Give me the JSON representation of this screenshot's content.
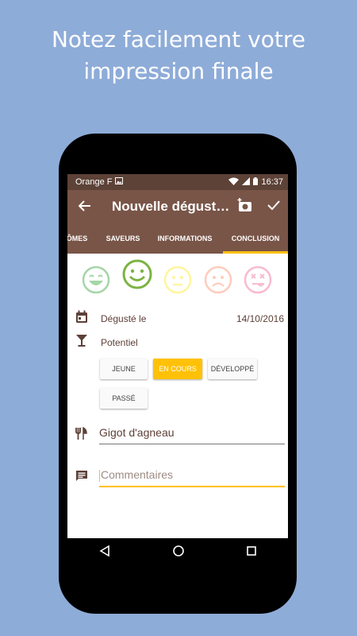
{
  "promo": {
    "headline_line1": "Notez facilement votre",
    "headline_line2": "impression finale"
  },
  "status_bar": {
    "carrier": "Orange F",
    "time": "16:37",
    "icons": [
      "image-icon",
      "wifi-icon",
      "signal-icon",
      "battery-icon"
    ]
  },
  "app_bar": {
    "title": "Nouvelle dégustati…",
    "actions": [
      "back-arrow-icon",
      "add-photo-icon",
      "check-icon"
    ]
  },
  "tabs": [
    {
      "label": "ÔMES",
      "active": false
    },
    {
      "label": "SAVEURS",
      "active": false
    },
    {
      "label": "INFORMATIONS",
      "active": false
    },
    {
      "label": "CONCLUSION",
      "active": true
    }
  ],
  "ratings": {
    "options": [
      "very-happy-face-icon",
      "smiling-face-icon",
      "neutral-face-icon",
      "sad-face-icon",
      "dead-face-icon"
    ],
    "selected_index": 1,
    "colors": [
      "#a5d6a7",
      "#8bc34a",
      "#fff59d",
      "#ffccbc",
      "#f8bbd0"
    ]
  },
  "tasted": {
    "label": "Dégusté le",
    "date": "14/10/2016",
    "icon": "calendar-icon"
  },
  "potential": {
    "label": "Potentiel",
    "icon": "wine-glass-icon",
    "options": [
      "JEUNE",
      "EN COURS",
      "DÉVELOPPÉ",
      "PASSÉ"
    ],
    "selected": "EN COURS"
  },
  "pairing": {
    "value": "Gigot d'agneau",
    "icon": "fork-knife-icon"
  },
  "comments": {
    "placeholder": "Commentaires",
    "icon": "comment-icon"
  },
  "nav": [
    "back-triangle-icon",
    "home-circle-icon",
    "recents-square-icon"
  ],
  "colors": {
    "background": "#8eacd8",
    "primary": "#795548",
    "primary_dark": "#5d4237",
    "accent": "#ffc107",
    "text": "#5d4037"
  }
}
